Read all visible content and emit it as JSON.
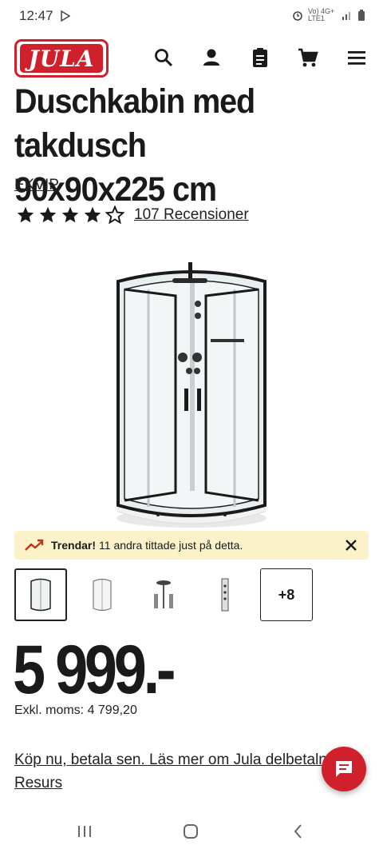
{
  "status": {
    "time": "12:47",
    "network": "Vo) 4G+ LTE1"
  },
  "header": {
    "logo_text": "JULA",
    "icons": [
      "search-icon",
      "account-icon",
      "shopping-list-icon",
      "cart-icon",
      "menu-icon"
    ]
  },
  "product": {
    "title_line1": "Duschkabin med takdusch",
    "title_line2": "90x90x225 cm",
    "brand": "EKVIP",
    "rating": 4,
    "rating_max": 5,
    "reviews": "107 Recensioner"
  },
  "trend": {
    "label": "Trendar!",
    "text": "11 andra tittade just på detta."
  },
  "thumbnails": {
    "more_label": "+8"
  },
  "price": {
    "value": "5 999.-",
    "vat": "Exkl. moms: 4 799,20"
  },
  "finance": {
    "line1": "Köp nu, betala sen. Läs mer om Jula delbetalning",
    "line2": "Resurs"
  },
  "colors": {
    "brand_red": "#d0202b",
    "banner_bg": "#fcf2c9"
  }
}
